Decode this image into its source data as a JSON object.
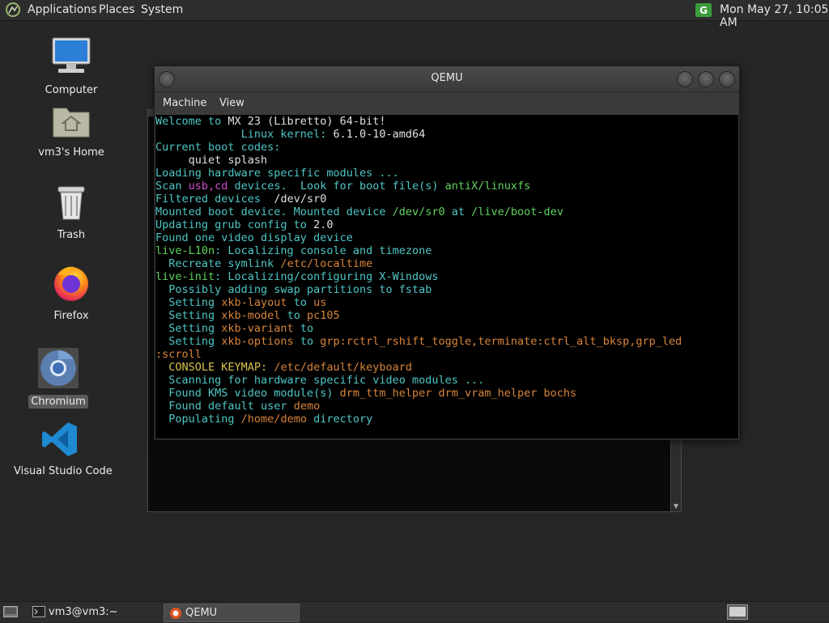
{
  "top_panel": {
    "menu": {
      "applications": "Applications",
      "places": "Places",
      "system": "System"
    },
    "clock": "Mon May 27, 10:05 AM"
  },
  "desktop": {
    "icons": [
      {
        "label": "Computer",
        "icon": "computer-icon"
      },
      {
        "label": "vm3's Home",
        "icon": "home-folder-icon"
      },
      {
        "label": "Trash",
        "icon": "trash-icon"
      },
      {
        "label": "Firefox",
        "icon": "firefox-icon"
      },
      {
        "label": "Chromium",
        "icon": "chromium-icon",
        "selected": true
      },
      {
        "label": "Visual Studio Code",
        "icon": "vscode-icon"
      }
    ]
  },
  "qemu": {
    "title": "QEMU",
    "menu": {
      "machine": "Machine",
      "view": "View"
    },
    "console_colors": {
      "white": "#e0e0e0",
      "cyan": "#4fc6c6",
      "green": "#5fd35f",
      "yellow": "#d8c24a",
      "orange": "#d8843a",
      "magenta": "#cf4fcf"
    },
    "console_lines": [
      [
        {
          "t": "Welcome to ",
          "c": "cyan"
        },
        {
          "t": "MX 23 (Libretto) 64-bit!",
          "c": "white"
        }
      ],
      [
        {
          "t": "             Linux kernel: ",
          "c": "cyan"
        },
        {
          "t": "6.1.0-10-amd64",
          "c": "white"
        }
      ],
      [
        {
          "t": "Current boot codes:",
          "c": "cyan"
        }
      ],
      [
        {
          "t": "     quiet splash",
          "c": "white"
        }
      ],
      [
        {
          "t": "Loading hardware specific modules ...",
          "c": "cyan"
        }
      ],
      [
        {
          "t": "Scan ",
          "c": "cyan"
        },
        {
          "t": "usb,cd",
          "c": "magenta"
        },
        {
          "t": " devices.  Look for boot file(s) ",
          "c": "cyan"
        },
        {
          "t": "antiX/linuxfs",
          "c": "green"
        }
      ],
      [
        {
          "t": "Filtered devices  ",
          "c": "cyan"
        },
        {
          "t": "/dev/sr0",
          "c": "white"
        }
      ],
      [
        {
          "t": "Mounted boot device. Mounted device ",
          "c": "cyan"
        },
        {
          "t": "/dev/sr0",
          "c": "green"
        },
        {
          "t": " at ",
          "c": "cyan"
        },
        {
          "t": "/live/boot-dev",
          "c": "green"
        }
      ],
      [
        {
          "t": "Updating grub config to ",
          "c": "cyan"
        },
        {
          "t": "2.0",
          "c": "white"
        }
      ],
      [
        {
          "t": "Found one video display device",
          "c": "cyan"
        }
      ],
      [
        {
          "t": "live-L10n",
          "c": "green"
        },
        {
          "t": ": Localizing console and timezone",
          "c": "cyan"
        }
      ],
      [
        {
          "t": "  Recreate symlink ",
          "c": "cyan"
        },
        {
          "t": "/etc/localtime",
          "c": "orange"
        }
      ],
      [
        {
          "t": "live-init",
          "c": "green"
        },
        {
          "t": ": Localizing/configuring X-Windows",
          "c": "cyan"
        }
      ],
      [
        {
          "t": "  Possibly adding swap partitions to fstab",
          "c": "cyan"
        }
      ],
      [
        {
          "t": "  Setting ",
          "c": "cyan"
        },
        {
          "t": "xkb-layout",
          "c": "orange"
        },
        {
          "t": " to ",
          "c": "cyan"
        },
        {
          "t": "us",
          "c": "orange"
        }
      ],
      [
        {
          "t": "  Setting ",
          "c": "cyan"
        },
        {
          "t": "xkb-model",
          "c": "orange"
        },
        {
          "t": " to ",
          "c": "cyan"
        },
        {
          "t": "pc105",
          "c": "orange"
        }
      ],
      [
        {
          "t": "  Setting ",
          "c": "cyan"
        },
        {
          "t": "xkb-variant",
          "c": "orange"
        },
        {
          "t": " to",
          "c": "cyan"
        }
      ],
      [
        {
          "t": "  Setting ",
          "c": "cyan"
        },
        {
          "t": "xkb-options",
          "c": "orange"
        },
        {
          "t": " to ",
          "c": "cyan"
        },
        {
          "t": "grp:rctrl_rshift_toggle,terminate:ctrl_alt_bksp,grp_led",
          "c": "orange"
        }
      ],
      [
        {
          "t": ":scroll",
          "c": "orange"
        }
      ],
      [
        {
          "t": "  CONSOLE KEYMAP: ",
          "c": "yellow"
        },
        {
          "t": "/etc/default/keyboard",
          "c": "orange"
        }
      ],
      [
        {
          "t": "  Scanning for hardware specific video modules ...",
          "c": "cyan"
        }
      ],
      [
        {
          "t": "  Found KMS video module(s) ",
          "c": "cyan"
        },
        {
          "t": "drm_ttm_helper drm_vram_helper bochs",
          "c": "orange"
        }
      ],
      [
        {
          "t": "  Found default user ",
          "c": "cyan"
        },
        {
          "t": "demo",
          "c": "orange"
        }
      ],
      [
        {
          "t": "  Populating ",
          "c": "cyan"
        },
        {
          "t": "/home/demo",
          "c": "orange"
        },
        {
          "t": " directory",
          "c": "cyan"
        }
      ]
    ]
  },
  "taskbar": {
    "tasks": [
      {
        "label": "vm3@vm3:~",
        "icon": "terminal-icon",
        "active": false
      },
      {
        "label": "QEMU",
        "icon": "qemu-icon",
        "active": true
      }
    ]
  }
}
